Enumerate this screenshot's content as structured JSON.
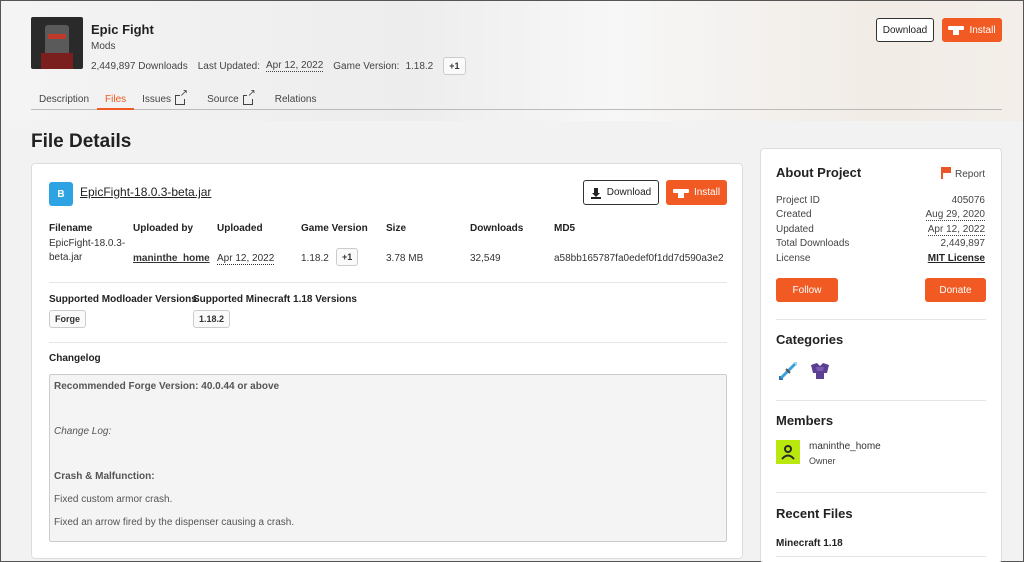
{
  "project": {
    "name": "Epic Fight",
    "category": "Mods",
    "downloads": "2,449,897 Downloads",
    "last_updated_label": "Last Updated:",
    "last_updated": "Apr 12, 2022",
    "game_version_label": "Game Version:",
    "game_version": "1.18.2",
    "more_versions": "+1"
  },
  "header_buttons": {
    "download": "Download",
    "install": "Install"
  },
  "tabs": [
    {
      "label": "Description"
    },
    {
      "label": "Files"
    },
    {
      "label": "Issues"
    },
    {
      "label": "Source"
    },
    {
      "label": "Relations"
    }
  ],
  "page_title": "File Details",
  "file": {
    "badge": "B",
    "name": "EpicFight-18.0.3-beta.jar",
    "download_label": "Download",
    "install_label": "Install",
    "columns": {
      "filename": "Filename",
      "uploaded_by": "Uploaded by",
      "uploaded": "Uploaded",
      "game_version": "Game Version",
      "size": "Size",
      "downloads": "Downloads",
      "md5": "MD5"
    },
    "values": {
      "filename_line1": "EpicFight-18.0.3-",
      "filename_line2": "beta.jar",
      "uploaded_by": "maninthe_home",
      "uploaded": "Apr 12, 2022",
      "game_version": "1.18.2",
      "game_version_more": "+1",
      "size": "3.78 MB",
      "downloads": "32,549",
      "md5": "a58bb165787fa0edef0f1dd7d590a3e2"
    },
    "modloaders_label": "Supported Modloader Versions",
    "modloader": "Forge",
    "mc_versions_label": "Supported Minecraft 1.18 Versions",
    "mc_version": "1.18.2",
    "changelog_label": "Changelog",
    "changelog": {
      "line1": "Recommended Forge Version: 40.0.44 or above",
      "line2": "Change Log:",
      "line3": "Crash & Malfunction:",
      "line4": "Fixed custom armor crash.",
      "line5": "Fixed an arrow fired by the dispenser causing a crash."
    }
  },
  "about": {
    "title": "About Project",
    "report": "Report",
    "rows": {
      "project_id_k": "Project ID",
      "project_id_v": "405076",
      "created_k": "Created",
      "created_v": "Aug 29, 2020",
      "updated_k": "Updated",
      "updated_v": "Apr 12, 2022",
      "total_k": "Total Downloads",
      "total_v": "2,449,897",
      "license_k": "License",
      "license_v": "MIT License"
    },
    "follow": "Follow",
    "donate": "Donate",
    "categories_title": "Categories",
    "members_title": "Members",
    "member_name": "maninthe_home",
    "member_role": "Owner",
    "recent_files_title": "Recent Files",
    "recent_files_group": "Minecraft 1.18"
  },
  "colors": {
    "accent": "#f15a22",
    "file_badge": "#2ea3e3",
    "avatar": "#b9e80f"
  }
}
